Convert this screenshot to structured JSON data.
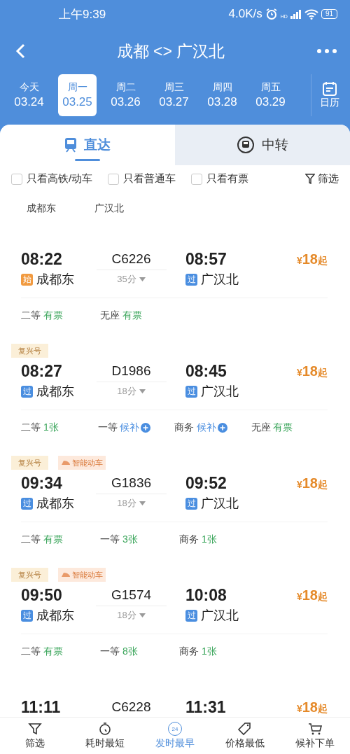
{
  "status_bar": {
    "time": "上午9:39",
    "speed": "4.0K/s",
    "hd_label": "HD",
    "battery": "91"
  },
  "header": {
    "title": "成都 <> 广汉北"
  },
  "dates": [
    {
      "weekday": "今天",
      "date": "03.24",
      "selected": false
    },
    {
      "weekday": "周一",
      "date": "03.25",
      "selected": true
    },
    {
      "weekday": "周二",
      "date": "03.26",
      "selected": false
    },
    {
      "weekday": "周三",
      "date": "03.27",
      "selected": false
    },
    {
      "weekday": "周四",
      "date": "03.28",
      "selected": false
    },
    {
      "weekday": "周五",
      "date": "03.29",
      "selected": false
    }
  ],
  "calendar": {
    "label": "日历"
  },
  "tabs": [
    {
      "label": "直达",
      "kind": "direct",
      "selected": true
    },
    {
      "label": "中转",
      "kind": "transfer",
      "selected": false
    }
  ],
  "filters": [
    {
      "label": "只看高铁/动车",
      "checked": false
    },
    {
      "label": "只看普通车",
      "checked": false
    },
    {
      "label": "只看有票",
      "checked": false
    }
  ],
  "filter_button": "筛选",
  "station_header": [
    "成都东",
    "广汉北"
  ],
  "trains": [
    {
      "depart": "08:22",
      "code": "C6226",
      "duration": "35分",
      "arrive": "08:57",
      "from_badge": {
        "kind": "start",
        "label": "始"
      },
      "from": "成都东",
      "to_badge": {
        "kind": "pass",
        "label": "过"
      },
      "to": "广汉北",
      "currency": "¥",
      "price": "18",
      "price_suffix": "起",
      "seats": [
        {
          "class": "二等",
          "availability": "有票",
          "kind": "available"
        },
        {
          "class": "无座",
          "availability": "有票",
          "kind": "available"
        }
      ]
    },
    {
      "tags": [
        {
          "label": "复兴号",
          "kind": "fuxing"
        }
      ],
      "depart": "08:27",
      "code": "D1986",
      "duration": "18分",
      "arrive": "08:45",
      "from_badge": {
        "kind": "pass",
        "label": "过"
      },
      "from": "成都东",
      "to_badge": {
        "kind": "pass",
        "label": "过"
      },
      "to": "广汉北",
      "currency": "¥",
      "price": "18",
      "price_suffix": "起",
      "seats": [
        {
          "class": "二等",
          "availability": "1张",
          "kind": "available"
        },
        {
          "class": "一等",
          "availability": "候补",
          "kind": "waitlist"
        },
        {
          "class": "商务",
          "availability": "候补",
          "kind": "waitlist"
        },
        {
          "class": "无座",
          "availability": "有票",
          "kind": "available"
        }
      ]
    },
    {
      "tags": [
        {
          "label": "复兴号",
          "kind": "fuxing"
        },
        {
          "label": "智能动车",
          "kind": "smart"
        }
      ],
      "depart": "09:34",
      "code": "G1836",
      "duration": "18分",
      "arrive": "09:52",
      "from_badge": {
        "kind": "pass",
        "label": "过"
      },
      "from": "成都东",
      "to_badge": {
        "kind": "pass",
        "label": "过"
      },
      "to": "广汉北",
      "currency": "¥",
      "price": "18",
      "price_suffix": "起",
      "seats": [
        {
          "class": "二等",
          "availability": "有票",
          "kind": "available"
        },
        {
          "class": "一等",
          "availability": "3张",
          "kind": "available"
        },
        {
          "class": "商务",
          "availability": "1张",
          "kind": "available"
        }
      ]
    },
    {
      "tags": [
        {
          "label": "复兴号",
          "kind": "fuxing"
        },
        {
          "label": "智能动车",
          "kind": "smart"
        }
      ],
      "depart": "09:50",
      "code": "G1574",
      "duration": "18分",
      "arrive": "10:08",
      "from_badge": {
        "kind": "pass",
        "label": "过"
      },
      "from": "成都东",
      "to_badge": {
        "kind": "pass",
        "label": "过"
      },
      "to": "广汉北",
      "currency": "¥",
      "price": "18",
      "price_suffix": "起",
      "seats": [
        {
          "class": "二等",
          "availability": "有票",
          "kind": "available"
        },
        {
          "class": "一等",
          "availability": "8张",
          "kind": "available"
        },
        {
          "class": "商务",
          "availability": "1张",
          "kind": "available"
        }
      ]
    },
    {
      "depart": "11:11",
      "code": "C6228",
      "arrive": "11:31",
      "currency": "¥",
      "price": "18",
      "price_suffix": "起"
    }
  ],
  "bottom_nav": [
    {
      "label": "筛选",
      "kind": "filter",
      "selected": false
    },
    {
      "label": "耗时最短",
      "kind": "timer",
      "selected": false
    },
    {
      "label": "发时最早",
      "kind": "clock24",
      "icon_text": "24",
      "selected": true
    },
    {
      "label": "价格最低",
      "kind": "tag",
      "selected": false
    },
    {
      "label": "候补下单",
      "kind": "cart",
      "selected": false
    }
  ]
}
